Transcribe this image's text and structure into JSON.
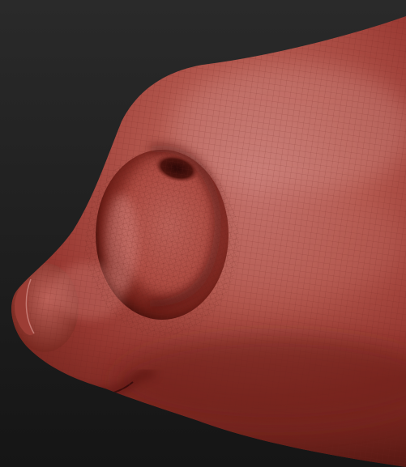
{
  "viewport": {
    "background": {
      "top_color": "#2a2a2a",
      "bottom_color": "#151515"
    },
    "model": {
      "subject": "sculpted-nose-side-view",
      "material": "red-wax-clay",
      "colors": {
        "base": "#a8483f",
        "highlight": "#c97a74",
        "mid": "#9a3a33",
        "shadow": "#5a1812",
        "deep_shadow": "#2f0a08",
        "wire": "#6e241e"
      },
      "wireframe_visible": true
    }
  }
}
